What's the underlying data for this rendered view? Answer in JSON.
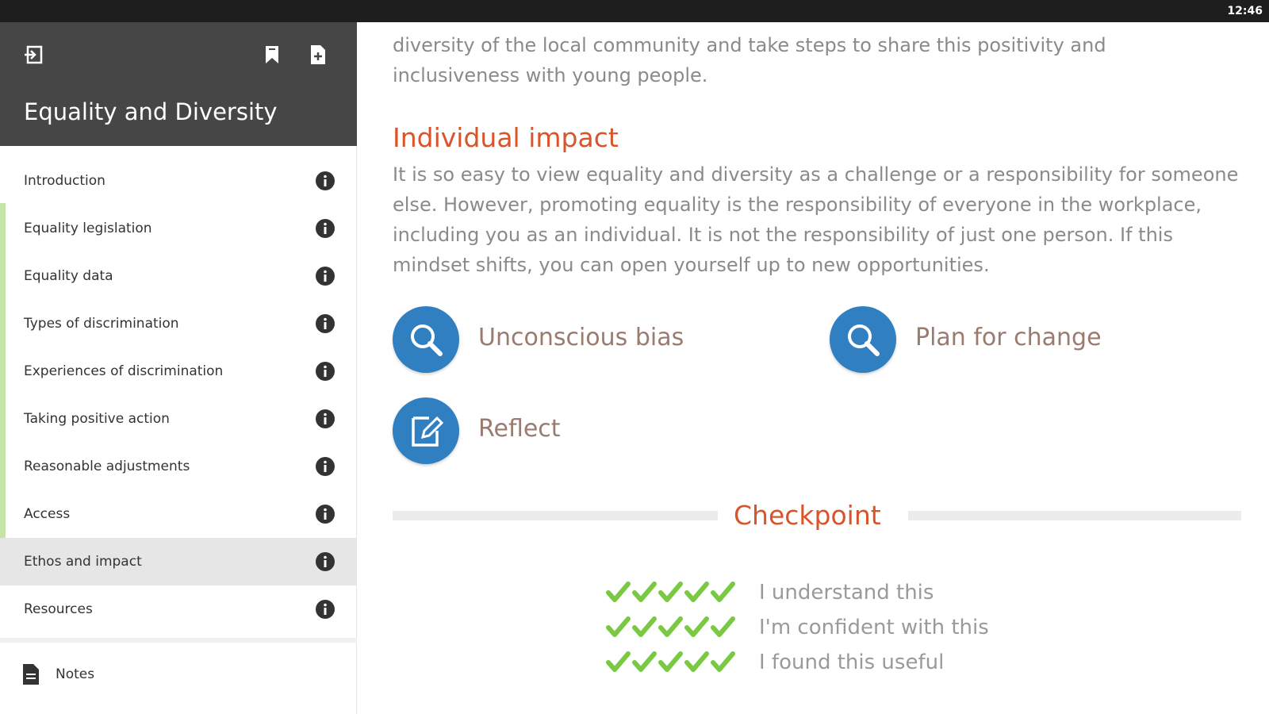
{
  "status_bar": {
    "time": "12:46"
  },
  "sidebar": {
    "title": "Equality and Diversity",
    "items": [
      {
        "label": "Introduction"
      },
      {
        "label": "Equality legislation"
      },
      {
        "label": "Equality data"
      },
      {
        "label": "Types of discrimination"
      },
      {
        "label": "Experiences of discrimination"
      },
      {
        "label": "Taking positive action"
      },
      {
        "label": "Reasonable adjustments"
      },
      {
        "label": "Access"
      },
      {
        "label": "Ethos and impact",
        "active": true
      },
      {
        "label": "Resources"
      }
    ],
    "notes_label": "Notes"
  },
  "content": {
    "intro_line1": "diversity of the local community and take steps to share this positivity and",
    "intro_line2": "inclusiveness with young people.",
    "section_heading": "Individual impact",
    "body_paragraph": "It is so easy to view equality and diversity as a challenge or a responsibility for someone else. However, promoting equality is the responsibility of everyone in the workplace, including you as an individual. It is not the responsibility of just one person. If this mindset shifts, you can open yourself up to new opportunities.",
    "tiles": [
      {
        "label": "Unconscious bias",
        "icon": "magnifier-icon"
      },
      {
        "label": "Plan for change",
        "icon": "magnifier-icon"
      },
      {
        "label": "Reflect",
        "icon": "edit-note-icon"
      }
    ],
    "checkpoint": {
      "title": "Checkpoint",
      "rows": [
        {
          "label": "I understand this"
        },
        {
          "label": "I'm confident with this"
        },
        {
          "label": "I found this useful"
        }
      ]
    }
  },
  "colors": {
    "accent_heading": "#d9542b",
    "icon_circle": "#2f7fc1",
    "check_green": "#7ac943",
    "header_bg": "#464646"
  }
}
